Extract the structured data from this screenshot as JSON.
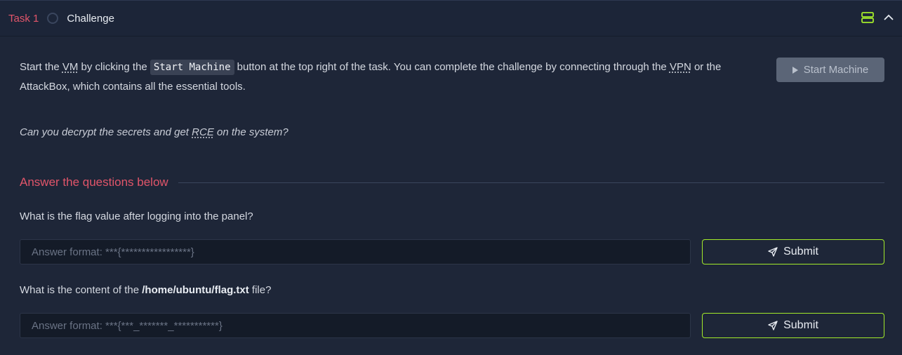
{
  "header": {
    "task_label": "Task 1",
    "task_title": "Challenge"
  },
  "intro": {
    "part1": "Start the ",
    "vm": "VM",
    "part2": " by clicking the ",
    "code": "Start Machine",
    "part3": " button at the top right of the task. You can complete the challenge by connecting through the ",
    "vpn": "VPN",
    "part4": " or the AttackBox, which contains all the essential tools."
  },
  "start_button": {
    "label": "Start Machine"
  },
  "question_intro": {
    "part1": "Can you decrypt the secrets and get ",
    "rce": "RCE",
    "part2": " on the system?"
  },
  "section": {
    "heading": "Answer the questions below"
  },
  "questions": [
    {
      "text": "What is the flag value after logging into the panel?",
      "placeholder": "Answer format: ***{*****************}",
      "submit_label": "Submit"
    },
    {
      "text_part1": "What is the content of the ",
      "text_bold": "/home/ubuntu/flag.txt",
      "text_part2": " file?",
      "placeholder": "Answer format: ***{***_*******_***********}",
      "submit_label": "Submit"
    }
  ],
  "colors": {
    "accent_red": "#e1556a",
    "accent_green": "#a3ea2a",
    "background": "#1e2638"
  }
}
